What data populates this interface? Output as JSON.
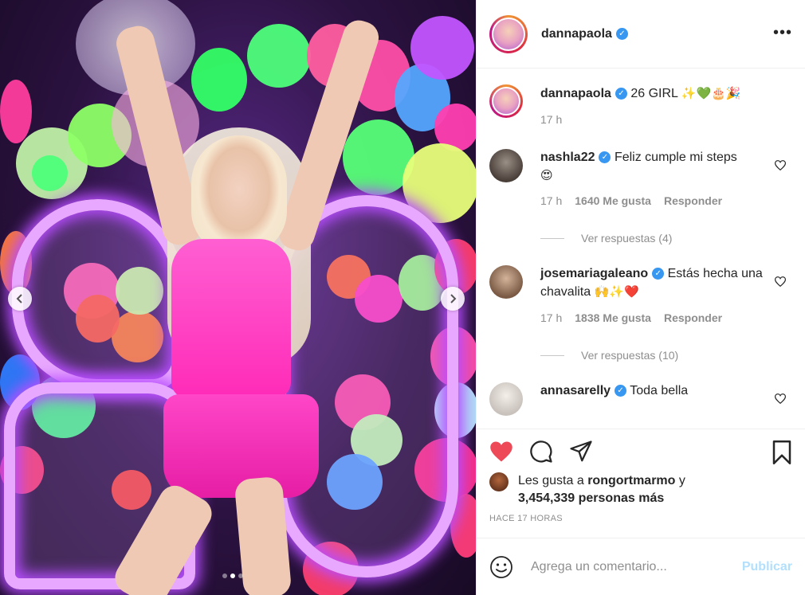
{
  "post": {
    "username": "dannapaola",
    "more_icon": "more-horizontal-icon",
    "caption": {
      "username": "dannapaola",
      "text": "26 GIRL",
      "emojis": "✨💚🎂🎉",
      "time": "17 h"
    },
    "comments": [
      {
        "username": "nashla22",
        "verified": true,
        "text": "Feliz cumple mi steps",
        "emoji": "😍",
        "time": "17 h",
        "likes": "1640 Me gusta",
        "reply": "Responder",
        "view_replies": "Ver respuestas (4)"
      },
      {
        "username": "josemariagaleano",
        "verified": true,
        "text": "Estás hecha una chavalita",
        "emoji": "🙌✨❤️",
        "time": "17 h",
        "likes": "1838 Me gusta",
        "reply": "Responder",
        "view_replies": "Ver respuestas (10)"
      },
      {
        "username": "annasarelly",
        "verified": true,
        "text": "Toda bella"
      }
    ],
    "likes_text_prefix": "Les gusta a",
    "likes_user": "rongortmarmo",
    "likes_and": "y",
    "likes_count": "3,454,339 personas más",
    "time_ago": "HACE 17 HORAS",
    "add_comment_placeholder": "Agrega un comentario...",
    "publish_label": "Publicar",
    "colors": {
      "heart_red": "#ed4956",
      "verified_blue": "#3897f0",
      "publish_disabled": "#b2dffc"
    },
    "carousel": {
      "total_slides": 3,
      "active_slide": 2
    }
  }
}
